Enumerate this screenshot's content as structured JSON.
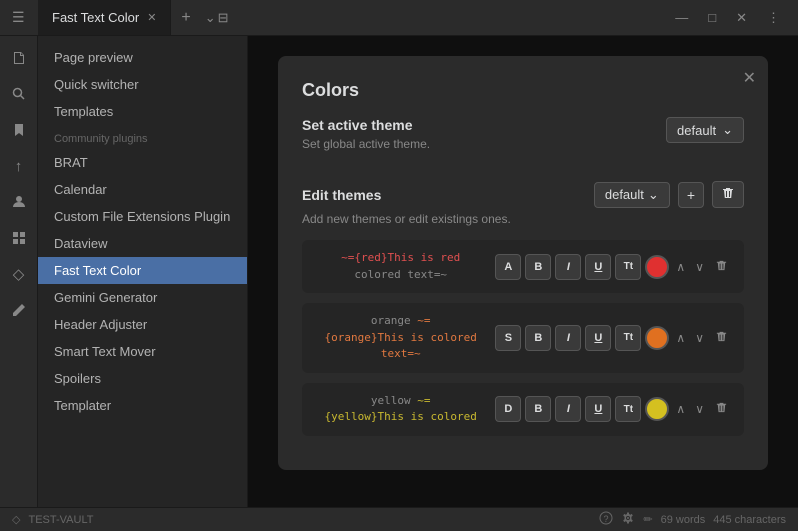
{
  "titlebar": {
    "tab_title": "Fast Text Color",
    "tab_close": "✕",
    "add_tab": "+",
    "minimize": "—",
    "maximize": "□",
    "close": "✕",
    "menu_icon": "⋮"
  },
  "iconbar": {
    "icons": [
      "📁",
      "🔍",
      "🔖",
      "↑",
      "👤",
      "⊞",
      "♦",
      "✏"
    ]
  },
  "sidebar": {
    "items": [
      {
        "label": "Page preview",
        "active": false
      },
      {
        "label": "Quick switcher",
        "active": false
      },
      {
        "label": "Templates",
        "active": false
      }
    ],
    "section_label": "Community plugins",
    "plugins": [
      {
        "label": "BRAT",
        "active": false
      },
      {
        "label": "Calendar",
        "active": false
      },
      {
        "label": "Custom File Extensions Plugin",
        "active": false,
        "multiline": true
      },
      {
        "label": "Dataview",
        "active": false
      },
      {
        "label": "Fast Text Color",
        "active": true
      },
      {
        "label": "Gemini Generator",
        "active": false
      },
      {
        "label": "Header Adjuster",
        "active": false
      },
      {
        "label": "Smart Text Mover",
        "active": false
      },
      {
        "label": "Spoilers",
        "active": false
      },
      {
        "label": "Templater",
        "active": false
      }
    ]
  },
  "modal": {
    "title": "Colors",
    "close_btn": "✕",
    "active_theme": {
      "title": "Set active theme",
      "desc": "Set global active theme.",
      "dropdown_label": "default",
      "dropdown_arrow": "⌄"
    },
    "edit_themes": {
      "title": "Edit themes",
      "desc": "Add new themes or edit existings ones.",
      "dropdown_label": "default",
      "dropdown_arrow": "⌄",
      "add_btn": "+",
      "delete_btn": "🗑"
    },
    "color_rows": [
      {
        "label": "red",
        "preview_syntax": "~={red}This is red",
        "preview_text": "colored text=~",
        "format_btn": "A",
        "bold_btn": "B",
        "italic_btn": "I",
        "underline_btn": "U",
        "tt_btn": "Tt",
        "color": "#e03030",
        "up_btn": "∧",
        "down_btn": "∨",
        "del_btn": "🗑"
      },
      {
        "label": "orange",
        "preview_syntax": "~=\n{orange}This is colored text=~",
        "preview_text": "",
        "format_btn": "S",
        "bold_btn": "B",
        "italic_btn": "I",
        "underline_btn": "U",
        "tt_btn": "Tt",
        "color": "#e07020",
        "up_btn": "∧",
        "down_btn": "∨",
        "del_btn": "🗑"
      },
      {
        "label": "yellow",
        "preview_syntax": "~=\n{yellow}This is colored",
        "preview_text": "",
        "format_btn": "D",
        "bold_btn": "B",
        "italic_btn": "I",
        "underline_btn": "U",
        "tt_btn": "Tt",
        "color": "#d4c020",
        "up_btn": "∧",
        "down_btn": "∨",
        "del_btn": "🗑"
      }
    ]
  },
  "statusbar": {
    "vault_icon": "◇",
    "vault_name": "TEST-VAULT",
    "help_icon": "?",
    "settings_icon": "⚙",
    "edit_icon": "✏",
    "word_count": "69 words",
    "char_count": "445 characters"
  }
}
